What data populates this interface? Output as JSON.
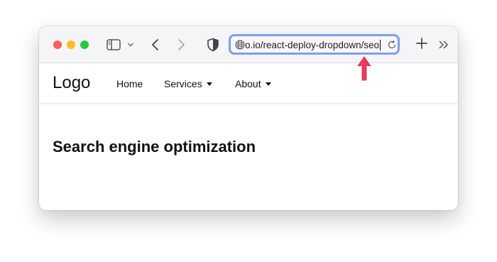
{
  "browser": {
    "url": "o.io/react-deploy-dropdown/seo"
  },
  "navbar": {
    "logo": "Logo",
    "items": [
      {
        "label": "Home"
      },
      {
        "label": "Services"
      },
      {
        "label": "About"
      }
    ]
  },
  "main": {
    "heading": "Search engine optimization"
  },
  "icons": {
    "sidebar": "sidebar-icon",
    "back": "chevron-left-icon",
    "forward": "chevron-right-icon",
    "privacy": "shield-icon",
    "site": "globe-icon",
    "reload": "reload-icon",
    "new_tab": "plus-icon",
    "more": "double-chevron-right-icon",
    "annotation": "up-arrow-icon"
  },
  "colors": {
    "close": "#fe5f57",
    "minimize": "#febc2e",
    "zoom": "#28c840",
    "focus_ring": "#7aa0ee",
    "annotation_arrow": "#ee3a5e"
  }
}
